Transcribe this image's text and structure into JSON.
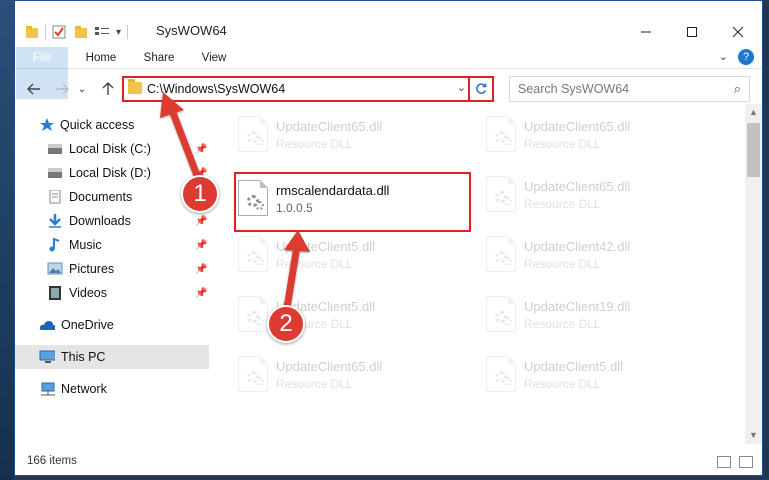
{
  "window": {
    "title": "SysWOW64"
  },
  "ribbon": {
    "tabs": [
      {
        "label": "File"
      },
      {
        "label": "Home"
      },
      {
        "label": "Share"
      },
      {
        "label": "View"
      }
    ],
    "help": "?"
  },
  "nav": {
    "address_path": "C:\\Windows\\SysWOW64",
    "search_placeholder": "Search SysWOW64"
  },
  "sidebar": {
    "items": [
      {
        "label": "Quick access",
        "icon": "star-icon",
        "pinned": false
      },
      {
        "label": "Local Disk (C:)",
        "icon": "drive-icon",
        "pinned": true
      },
      {
        "label": "Local Disk (D:)",
        "icon": "drive-icon",
        "pinned": true
      },
      {
        "label": "Documents",
        "icon": "documents-icon",
        "pinned": true
      },
      {
        "label": "Downloads",
        "icon": "downloads-icon",
        "pinned": true
      },
      {
        "label": "Music",
        "icon": "music-icon",
        "pinned": true
      },
      {
        "label": "Pictures",
        "icon": "pictures-icon",
        "pinned": true
      },
      {
        "label": "Videos",
        "icon": "videos-icon",
        "pinned": true
      },
      {
        "label": "OneDrive",
        "icon": "onedrive-icon",
        "pinned": false
      },
      {
        "label": "This PC",
        "icon": "this-pc-icon",
        "pinned": false,
        "selected": true
      },
      {
        "label": "Network",
        "icon": "network-icon",
        "pinned": false
      }
    ]
  },
  "files": {
    "left": [
      {
        "name": "UpdateClient65.dll",
        "desc": "Resource DLL"
      },
      {
        "name": "rmscalendardata.dll",
        "desc": "1.0.0.5"
      },
      {
        "name": "UpdateClient5.dll",
        "desc": "Resource DLL"
      },
      {
        "name": "UpdateClient5.dll",
        "desc": "Resource DLL"
      },
      {
        "name": "UpdateClient65.dll",
        "desc": "Resource DLL"
      }
    ],
    "right": [
      {
        "name": "UpdateClient65.dll",
        "desc": "Resource DLL"
      },
      {
        "name": "UpdateClient65.dll",
        "desc": "Resource DLL"
      },
      {
        "name": "UpdateClient42.dll",
        "desc": "Resource DLL"
      },
      {
        "name": "UpdateClient19.dll",
        "desc": "Resource DLL"
      },
      {
        "name": "UpdateClient5.dll",
        "desc": "Resource DLL"
      }
    ]
  },
  "status": {
    "item_count": "166 items"
  },
  "annotations": {
    "step1": "1",
    "step2": "2",
    "color": "#dc3b32"
  }
}
